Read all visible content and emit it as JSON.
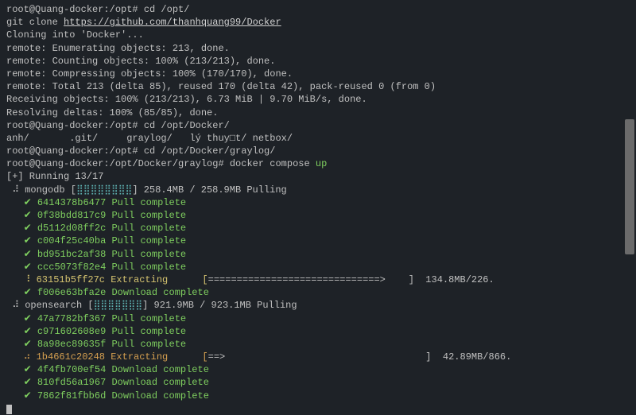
{
  "lines": {
    "l0": "root@Quang-docker:/opt# ",
    "cmd0": "cd /opt/",
    "l1a": "git clone ",
    "l1b": "https://github.com/thanhquang99/Docker",
    "l2": "Cloning into 'Docker'...",
    "l3": "remote: Enumerating objects: 213, done.",
    "l4": "remote: Counting objects: 100% (213/213), done.",
    "l5": "remote: Compressing objects: 100% (170/170), done.",
    "l6": "remote: Total 213 (delta 85), reused 170 (delta 42), pack-reused 0 (from 0)",
    "l7": "Receiving objects: 100% (213/213), 6.73 MiB | 9.70 MiB/s, done.",
    "l8": "Resolving deltas: 100% (85/85), done.",
    "p9": "root@Quang-docker:/opt# ",
    "cmd9": "cd /opt/Docker/",
    "l10": "anh/       .git/     graylog/   lý thuy□t/ netbox/",
    "p11": "root@Quang-docker:/opt# ",
    "cmd11": "cd /opt/Docker/graylog/",
    "p12": "root@Quang-docker:/opt/Docker/graylog# ",
    "cmd12a": "docker compose ",
    "cmd12b": "up",
    "l13a": "[+] Running 13/17",
    "svc1": " ⠼ mongodb [",
    "svc1bar": "⣿⣿⣿⣿⣿⣿⣿⣿",
    "svc1b": "] 258.4MB / 258.9MB Pulling",
    "m1": "   ✔ 6414378b6477 Pull complete",
    "m2": "   ✔ 0f38bdd817c9 Pull complete",
    "m3": "   ✔ d5112d08ff2c Pull complete",
    "m4": "   ✔ c004f25c40ba Pull complete",
    "m5": "   ✔ bd951bc2af38 Pull complete",
    "m6": "   ✔ ccc5073f82e4 Pull complete",
    "m7a": "   ⠸ 63151b5ff27c Extracting      [",
    "m7b": "==============================>",
    "m7c": "    ]  134.8MB/226.",
    "m8": "   ✔ f006e63bfa2e Download complete",
    "svc2": " ⠼ opensearch [",
    "svc2bar": "⣿⣿⣿⣿⣿⣿⣿",
    "svc2b": "] 921.9MB / 923.1MB Pulling",
    "o1": "   ✔ 47a7782bf367 Pull complete",
    "o2": "   ✔ c971602608e9 Pull complete",
    "o3": "   ✔ 8a98ec89635f Pull complete",
    "o4a": "   ⠴ 1b4661c20248 Extracting      [",
    "o4b": "==>",
    "o4c": "                                   ]  42.89MB/866.",
    "o5": "   ✔ 4f4fb700ef54 Download complete",
    "o6": "   ✔ 810fd56a1967 Download complete",
    "o7": "   ✔ 7862f81fbb6d Download complete"
  }
}
